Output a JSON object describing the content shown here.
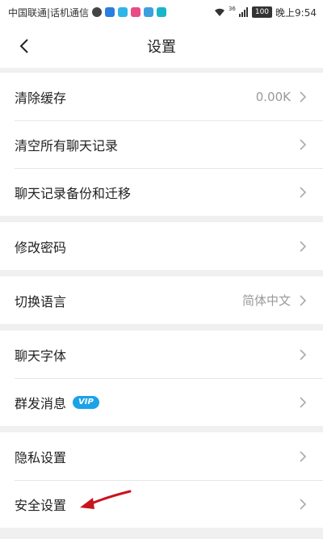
{
  "status_bar": {
    "carrier": "中国联通|话机通信",
    "signal_text": "36",
    "battery": "100",
    "time": "晚上9:54"
  },
  "nav": {
    "title": "设置"
  },
  "groups": [
    {
      "items": [
        {
          "label": "清除缓存",
          "value": "0.00K"
        },
        {
          "label": "清空所有聊天记录",
          "value": ""
        },
        {
          "label": "聊天记录备份和迁移",
          "value": ""
        }
      ]
    },
    {
      "items": [
        {
          "label": "修改密码",
          "value": ""
        }
      ]
    },
    {
      "items": [
        {
          "label": "切换语言",
          "value": "简体中文"
        }
      ]
    },
    {
      "items": [
        {
          "label": "聊天字体",
          "value": ""
        },
        {
          "label": "群发消息",
          "value": "",
          "badge": "VIP"
        }
      ]
    },
    {
      "items": [
        {
          "label": "隐私设置",
          "value": ""
        },
        {
          "label": "安全设置",
          "value": ""
        }
      ]
    }
  ],
  "colors": {
    "vip_badge": "#1aa3e8",
    "annotation_arrow": "#c8141e",
    "background": "#f0f0f0"
  },
  "icons": {
    "back": "chevron-left-icon",
    "row_arrow": "chevron-right-icon",
    "wifi": "wifi-icon",
    "signal": "signal-icon"
  }
}
